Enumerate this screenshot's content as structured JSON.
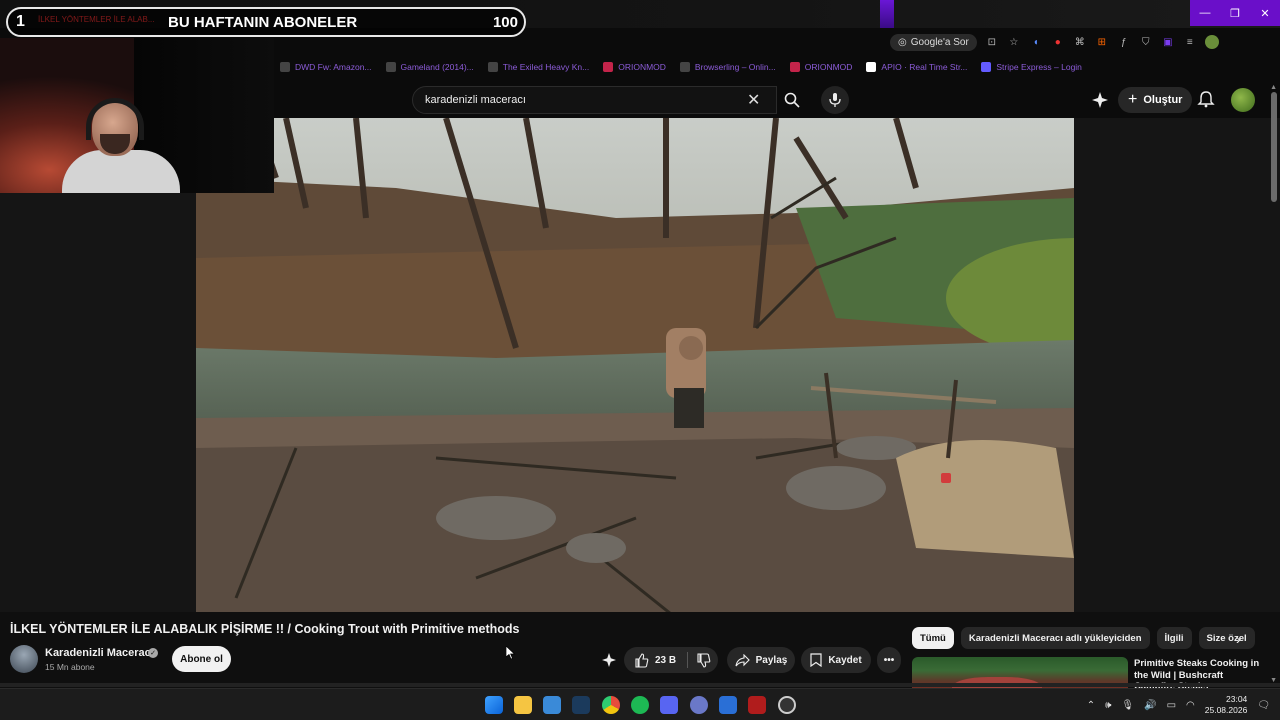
{
  "overlay": {
    "rank": "1",
    "title": "BU HAFTANIN ABONELER",
    "count": "100",
    "tab_ghost_text": "İLKEL YÖNTEMLER İLE ALAB..."
  },
  "browser": {
    "google_ask": "Google'a Sor",
    "bookmarks": [
      {
        "label": "DWD Fw: Amazon...",
        "color": "#6b3fc4"
      },
      {
        "label": "Gameland (2014)...",
        "color": "#6b3fc4"
      },
      {
        "label": "The Exiled Heavy Kn...",
        "color": "#6b3fc4"
      },
      {
        "label": "ORIONMOD",
        "color": "#6b3fc4"
      },
      {
        "label": "Browserling – Onlin...",
        "color": "#6b3fc4"
      },
      {
        "label": "ORIONMOD",
        "color": "#6b3fc4"
      },
      {
        "label": "APIO · Real Time Str...",
        "color": "#6b3fc4"
      },
      {
        "label": "Stripe Express – Login",
        "color": "#6b3fc4"
      }
    ]
  },
  "youtube": {
    "search_value": "karadenizli maceracı",
    "create_label": "Oluştur",
    "video_title": "İLKEL YÖNTEMLER İLE ALABALIK PİŞİRME !! / Cooking Trout with Primitive methods",
    "channel_name": "Karadenizli Maceracı",
    "subscriber_count": "15 Mn abone",
    "subscribe_label": "Abone ol",
    "like_count": "23 B",
    "share_label": "Paylaş",
    "save_label": "Kaydet",
    "chips": [
      "Tümü",
      "Karadenizli Maceracı adlı yükleyiciden",
      "İlgili",
      "Size özel"
    ],
    "recommended_title": "Primitive Steaks Cooking in the Wild | Bushcraft Campfire Steaks Compilation"
  },
  "taskbar": {
    "time": "23:04",
    "date": "25.08.2026"
  },
  "colors": {
    "accent_purple": "#6a0fc9",
    "background": "#0f0f0f",
    "chip_active": "#f1f1f1"
  }
}
